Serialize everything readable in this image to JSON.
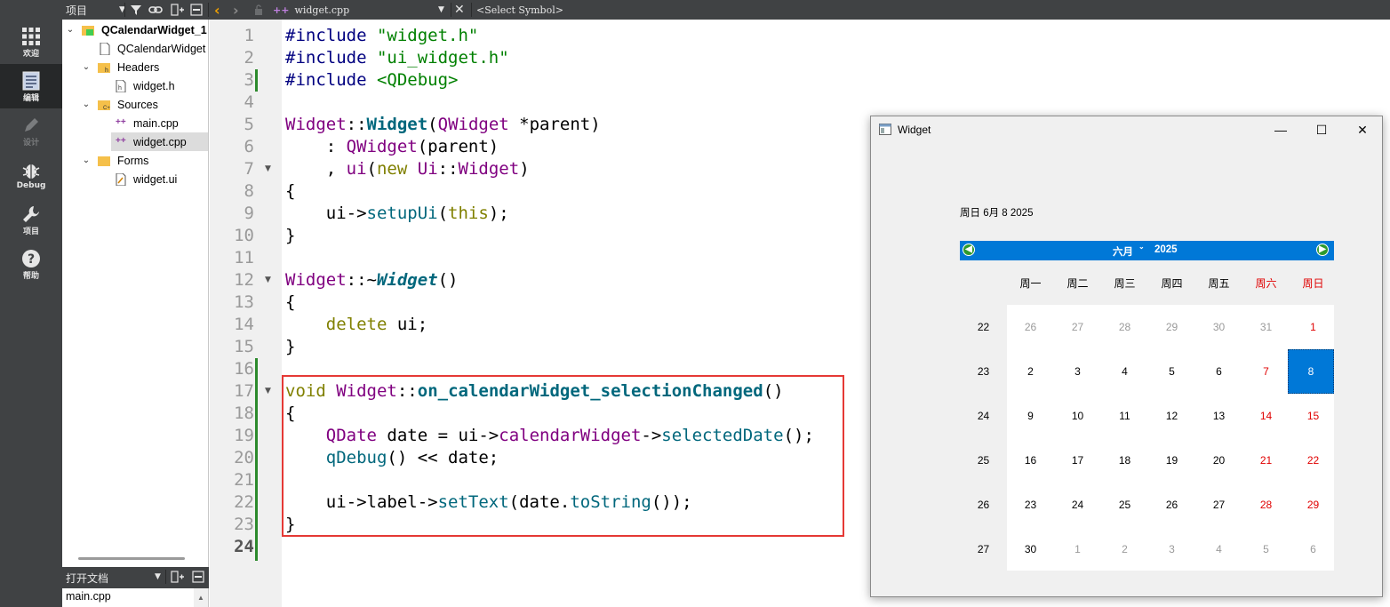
{
  "topbar": {
    "project_label": "项目",
    "file_name": "widget.cpp",
    "symbol_placeholder": "<Select Symbol>"
  },
  "modes": [
    {
      "label": "欢迎",
      "icon": "grid-icon"
    },
    {
      "label": "编辑",
      "icon": "edit-icon"
    },
    {
      "label": "设计",
      "icon": "pen-icon"
    },
    {
      "label": "Debug",
      "icon": "bug-icon"
    },
    {
      "label": "项目",
      "icon": "wrench-icon"
    },
    {
      "label": "帮助",
      "icon": "help-icon"
    }
  ],
  "tree": {
    "project": "QCalendarWidget_1",
    "items": [
      "QCalendarWidget",
      "Headers",
      "widget.h",
      "Sources",
      "main.cpp",
      "widget.cpp",
      "Forms",
      "widget.ui"
    ]
  },
  "open_docs": {
    "title": "打开文档",
    "items": [
      "main.cpp"
    ]
  },
  "editor": {
    "line_numbers": [
      "1",
      "2",
      "3",
      "4",
      "5",
      "6",
      "7",
      "8",
      "9",
      "10",
      "11",
      "12",
      "13",
      "14",
      "15",
      "16",
      "17",
      "18",
      "19",
      "20",
      "21",
      "22",
      "23",
      "24"
    ],
    "l1a": "#include",
    "l1b": "\"widget.h\"",
    "l2a": "#include",
    "l2b": "\"ui_widget.h\"",
    "l3a": "#include",
    "l3b": "<QDebug>",
    "l5_cls": "Widget",
    "l5_sep": "::",
    "l5_fn": "Widget",
    "l5_p1": "(",
    "l5_type": "QWidget",
    "l5_rest": " *parent)",
    "l6_pre": "    : ",
    "l6_cls": "QWidget",
    "l6_rest": "(parent)",
    "l7_pre": "    , ",
    "l7_ui": "ui",
    "l7_p": "(",
    "l7_new": "new",
    "l7_sp": " ",
    "l7_ns": "Ui",
    "l7_sep": "::",
    "l7_cls": "Widget",
    "l7_end": ")",
    "l8": "{",
    "l9_pre": "    ui->",
    "l9_fn": "setupUi",
    "l9_p": "(",
    "l9_kw": "this",
    "l9_end": ");",
    "l10": "}",
    "l12_cls": "Widget",
    "l12_sep": "::~",
    "l12_fn": "Widget",
    "l12_end": "()",
    "l13": "{",
    "l14_pre": "    ",
    "l14_kw": "delete",
    "l14_rest": " ui;",
    "l15": "}",
    "l17_kw": "void",
    "l17_sp": " ",
    "l17_cls": "Widget",
    "l17_sep": "::",
    "l17_fn": "on_calendarWidget_selectionChanged",
    "l17_end": "()",
    "l18": "{",
    "l19_pre": "    ",
    "l19_type": "QDate",
    "l19_var": " date = ui->",
    "l19_mem": "calendarWidget",
    "l19_arrow": "->",
    "l19_fn": "selectedDate",
    "l19_end": "();",
    "l20_pre": "    ",
    "l20_fn": "qDebug",
    "l20_rest": "() << date;",
    "l22_pre": "    ui->label->",
    "l22_fn": "setText",
    "l22_p": "(date.",
    "l22_fn2": "toString",
    "l22_end": "());",
    "l23": "}"
  },
  "widget_window": {
    "title": "Widget",
    "date_label": "周日 6月 8 2025",
    "calendar": {
      "month": "六月",
      "year": "2025",
      "weekdays": [
        "周一",
        "周二",
        "周三",
        "周四",
        "周五",
        "周六",
        "周日"
      ],
      "weeks": [
        "22",
        "23",
        "24",
        "25",
        "26",
        "27"
      ],
      "days": [
        [
          "26",
          "27",
          "28",
          "29",
          "30",
          "31",
          "1"
        ],
        [
          "2",
          "3",
          "4",
          "5",
          "6",
          "7",
          "8"
        ],
        [
          "9",
          "10",
          "11",
          "12",
          "13",
          "14",
          "15"
        ],
        [
          "16",
          "17",
          "18",
          "19",
          "20",
          "21",
          "22"
        ],
        [
          "23",
          "24",
          "25",
          "26",
          "27",
          "28",
          "29"
        ],
        [
          "30",
          "1",
          "2",
          "3",
          "4",
          "5",
          "6"
        ]
      ],
      "selected": "8",
      "colors": {
        "accent": "#0078d7",
        "weekend": "#e00000",
        "other_month": "#9a9a9a"
      }
    }
  }
}
